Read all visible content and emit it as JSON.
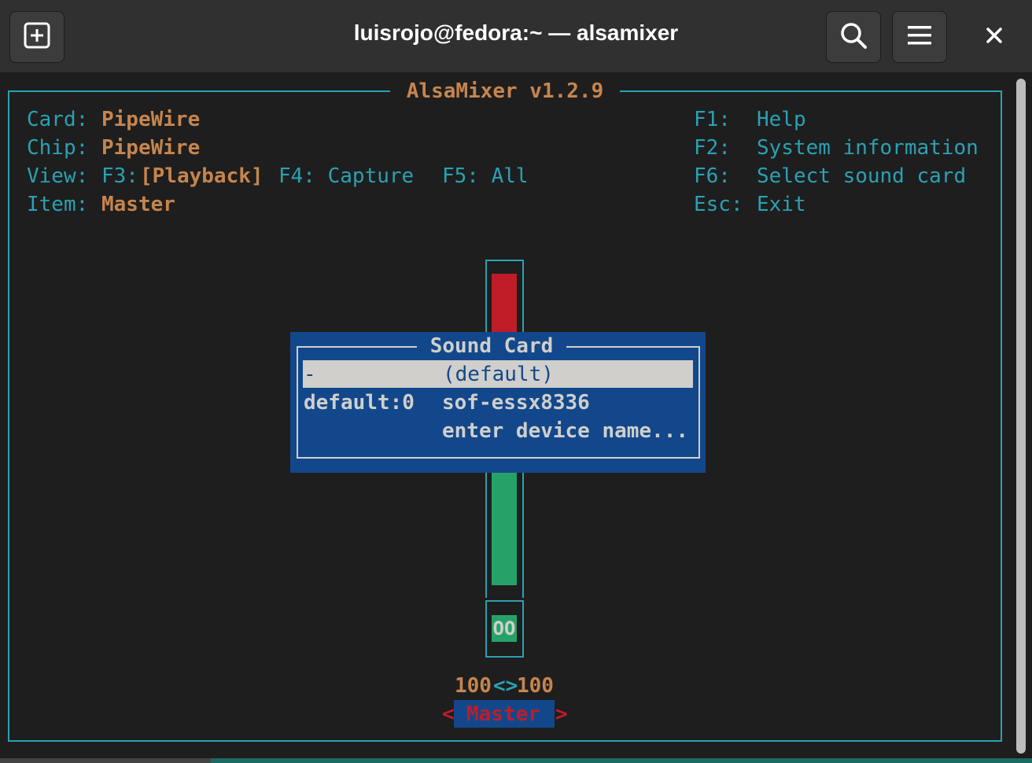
{
  "window": {
    "title": "luisrojo@fedora:~ — alsamixer",
    "new_tab_icon": "plus-square-icon",
    "search_icon": "search-icon",
    "menu_icon": "hamburger-menu-icon",
    "close_icon": "close-icon"
  },
  "alsamixer": {
    "title": "AlsaMixer v1.2.9",
    "card_label": "Card:",
    "card_value": "PipeWire",
    "chip_label": "Chip:",
    "chip_value": "PipeWire",
    "view_label": "View:",
    "view_f3_key": "F3:",
    "view_f3_value": "[Playback]",
    "view_f4": "F4: Capture",
    "view_f5": "F5: All",
    "item_label": "Item:",
    "item_value": "Master",
    "keys": [
      {
        "key": "F1:",
        "action": "Help"
      },
      {
        "key": "F2:",
        "action": "System information"
      },
      {
        "key": "F6:",
        "action": "Select sound card"
      },
      {
        "key": "Esc:",
        "action": "Exit"
      }
    ],
    "control": {
      "name": "Master",
      "left_volume": "100",
      "separator": "<>",
      "right_volume": "100",
      "mute_state": "OO",
      "arrow_left": "<",
      "arrow_right": ">"
    }
  },
  "sound_card_dialog": {
    "title": "Sound Card",
    "items": [
      {
        "device": "-",
        "name": "(default)",
        "selected": true
      },
      {
        "device": "default:0",
        "name": "sof-essx8336",
        "selected": false
      },
      {
        "device": "",
        "name": "enter device name...",
        "selected": false
      }
    ]
  },
  "colors": {
    "cyan": "#2aa1b3",
    "brown": "#c6854e",
    "dialog_blue": "#12488b",
    "red": "#c01c28",
    "green": "#26a269"
  }
}
